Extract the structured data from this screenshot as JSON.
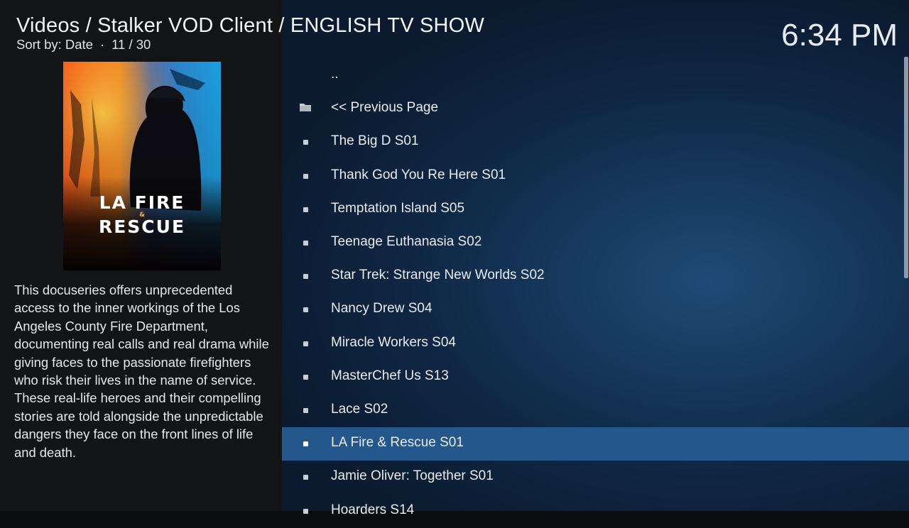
{
  "header": {
    "title": "Videos / Stalker VOD Client / ENGLISH TV SHOW",
    "sort_label": "Sort by: Date",
    "separator": "·",
    "position": "11 / 30",
    "clock": "6:34 PM"
  },
  "poster": {
    "title_line1": "LA FIRE",
    "ampersand": "&",
    "title_line2": "RESCUE"
  },
  "plot": "This docuseries offers unprecedented access to the inner workings of the Los Angeles County Fire Department, documenting real calls and real drama while giving faces to the passionate firefighters who risk their lives in the name of service. These real-life heroes and their compelling stories are told alongside the unpredictable dangers they face on the front lines of life and death.",
  "list": {
    "items": [
      {
        "label": "..",
        "icon": "none"
      },
      {
        "label": "<< Previous Page",
        "icon": "folder-icon"
      },
      {
        "label": "The Big D S01",
        "icon": "bullet-icon"
      },
      {
        "label": "Thank God You Re Here S01",
        "icon": "bullet-icon"
      },
      {
        "label": "Temptation Island S05",
        "icon": "bullet-icon"
      },
      {
        "label": "Teenage Euthanasia S02",
        "icon": "bullet-icon"
      },
      {
        "label": "Star Trek: Strange New Worlds S02",
        "icon": "bullet-icon"
      },
      {
        "label": "Nancy Drew S04",
        "icon": "bullet-icon"
      },
      {
        "label": "Miracle Workers S04",
        "icon": "bullet-icon"
      },
      {
        "label": "MasterChef Us S13",
        "icon": "bullet-icon"
      },
      {
        "label": "Lace S02",
        "icon": "bullet-icon"
      },
      {
        "label": "LA Fire & Rescue S01",
        "icon": "bullet-icon",
        "selected": true
      },
      {
        "label": "Jamie Oliver: Together S01",
        "icon": "bullet-icon"
      },
      {
        "label": "Hoarders S14",
        "icon": "bullet-icon"
      }
    ]
  },
  "colors": {
    "selection": "#24578c",
    "left_panel": "#121416",
    "list_background": "#163a5e"
  }
}
